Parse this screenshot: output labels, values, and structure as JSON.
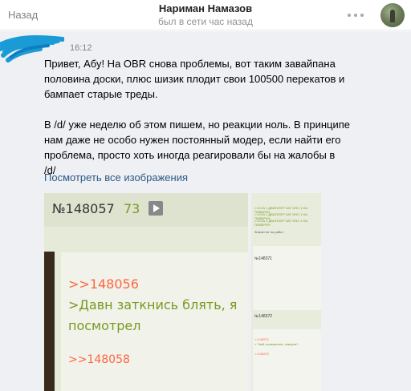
{
  "header": {
    "back_label": "Назад",
    "title": "Нариман Намазов",
    "status": "был в сети час назад"
  },
  "message": {
    "time": "16:12",
    "paragraph1": "Привет, Абу! На OBR снова проблемы, вот таким завайпана\nполовина доски, плюс шизик плодит свои 100500 перекатов и\nбампает старые треды.",
    "paragraph2": "В /d/ уже неделю об этом пишем, но реакции ноль. В принципе\nнам даже не особо нужен постоянный модер, если найти его\nпроблема, просто хоть иногда реагировали бы на жалобы в\n/d/",
    "view_all_images": "Посмотреть все изображения"
  },
  "image_main": {
    "post_number": "№148057",
    "reply_count": "73",
    "reply_link_1": ">>148056",
    "greentext_line1": ">Давн заткнись блять, я",
    "greentext_line2": "посмотрел",
    "reply_link_2": ">>148058"
  },
  "image_side": {
    "num1": "№148371",
    "num2": "№148372",
    "tiny_lines": [
      ">>ССА 1 ДВИГАТЕР ЗАТ ОНС 1 НА ПОВЕРХН",
      ">>ССА 1 ДВИГАТЕР ЗАТ ОНС 1 НА ПОВЕРХН",
      ">>ССА 1 ДВИГАТЕР ЗАТ ОНС 1 НА ПОВЕРХН",
      "Значит не ты работ"
    ],
    "reply_small_1": ">>148371",
    "green_small": "> Твой полиматель, завхуна?",
    "reply_small_2": ">>148372"
  },
  "colors": {
    "link": "#2a5885",
    "greentext": "#789922",
    "reply_link": "#ff6541",
    "status_gray": "#939393",
    "scribble_blue": "#1a9bd6"
  }
}
